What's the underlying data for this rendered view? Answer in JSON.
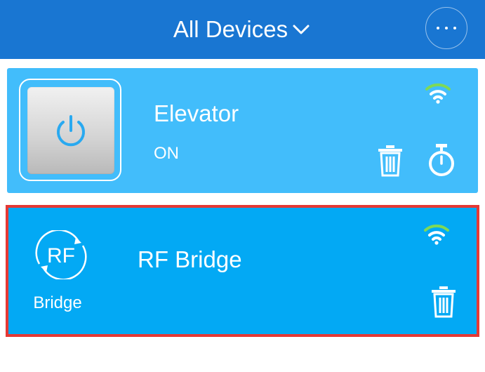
{
  "header": {
    "title": "All Devices",
    "dropdown_icon": "chevron-down-icon",
    "more_icon": "more-horizontal-icon",
    "color": "#1976d2"
  },
  "devices": [
    {
      "name": "Elevator",
      "status": "ON",
      "icon": "power-icon",
      "card_color": "#42bdfb",
      "wifi_icon": "wifi-icon",
      "actions": [
        "trash-icon",
        "timer-icon"
      ]
    },
    {
      "name": "RF Bridge",
      "icon_text": "RF",
      "icon_caption": "Bridge",
      "icon": "rf-bridge-icon",
      "card_color": "#03a9f4",
      "highlight_color": "#e53935",
      "wifi_icon": "wifi-icon",
      "actions": [
        "trash-icon"
      ]
    }
  ]
}
